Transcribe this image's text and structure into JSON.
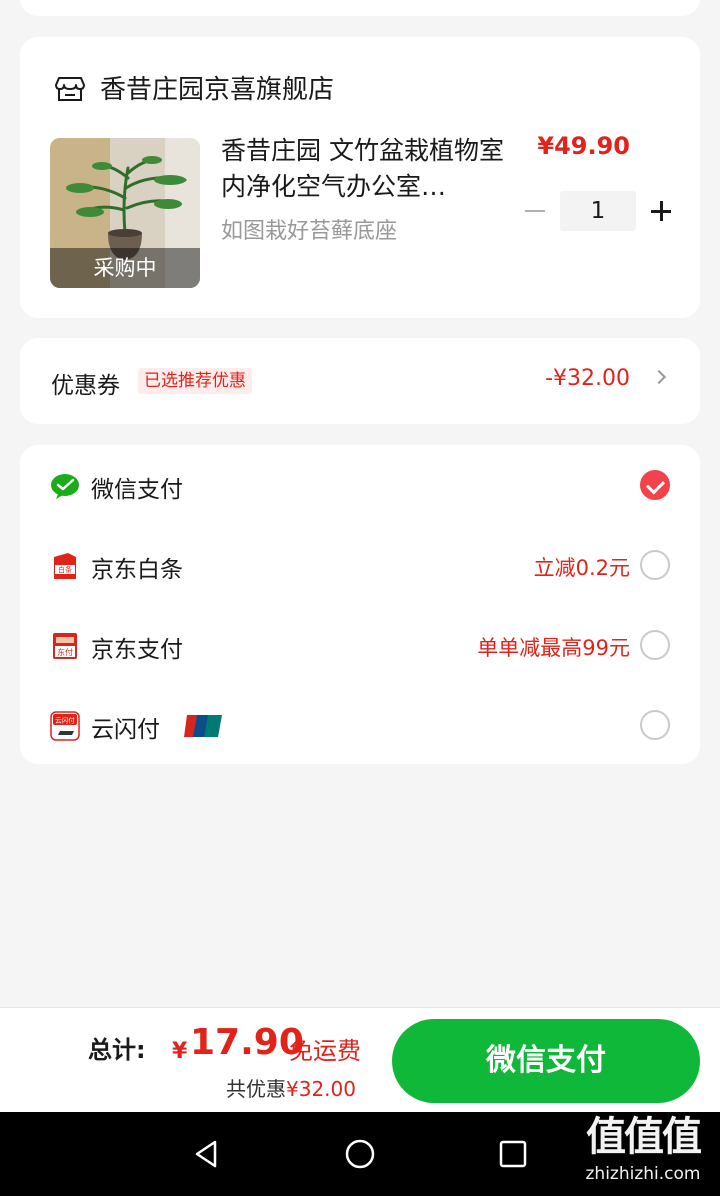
{
  "shop": {
    "name": "香昔庄园京喜旗舰店",
    "product": {
      "title": "香昔庄园 文竹盆栽植物室内净化空气办公室…",
      "spec": "如图栽好苔藓底座",
      "price": "¥49.90",
      "quantity": "1",
      "status_tag": "采购中"
    }
  },
  "coupon": {
    "label": "优惠券",
    "tag": "已选推荐优惠",
    "amount": "-¥32.00"
  },
  "payment_methods": [
    {
      "label": "微信支付",
      "promo": "",
      "selected": true,
      "icon": "wechat-pay-icon"
    },
    {
      "label": "京东白条",
      "promo": "立减0.2元",
      "selected": false,
      "icon": "jd-baitiao-icon"
    },
    {
      "label": "京东支付",
      "promo": "单单减最高99元",
      "selected": false,
      "icon": "jd-pay-icon"
    },
    {
      "label": "云闪付",
      "promo": "",
      "selected": false,
      "icon": "unionpay-quickpass-icon"
    }
  ],
  "bottom_bar": {
    "total_label": "总计:",
    "currency": "¥",
    "total_amount": "17.90",
    "free_shipping": "免运费",
    "saved_label": "共优惠",
    "saved_amount": "¥32.00",
    "pay_button": "微信支付"
  },
  "watermark": {
    "glyph": "值值值",
    "url": "zhizhizhi.com"
  },
  "colors": {
    "accent_red": "#e2231a",
    "wechat_green": "#10b83a",
    "checked_red": "#f3434a"
  }
}
